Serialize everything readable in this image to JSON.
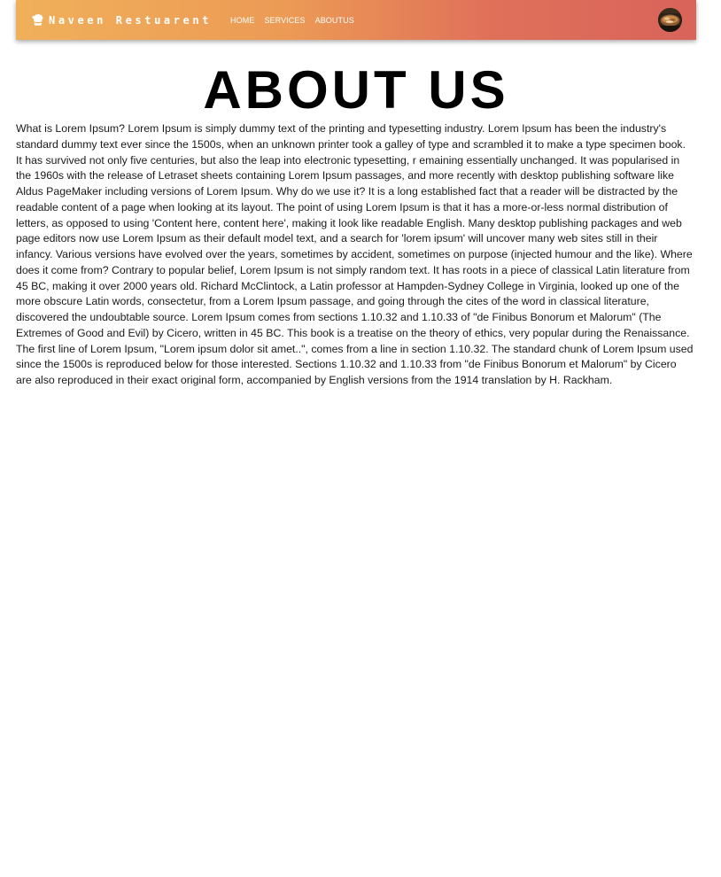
{
  "navbar": {
    "brand_icon": "chef-hat-icon",
    "brand_name": "Naveen Restuarent",
    "links": [
      {
        "label": "HOME"
      },
      {
        "label": "SERVICES"
      },
      {
        "label": "ABOUTUS"
      }
    ],
    "avatar_icon": "food-avatar-image",
    "gradient_colors": [
      "#f0b05a",
      "#e0705a",
      "#d8645a"
    ]
  },
  "main": {
    "title": "ABOUT US",
    "body": "What is Lorem Ipsum? Lorem Ipsum is simply dummy text of the printing and typesetting industry. Lorem Ipsum has been the industry's standard dummy text ever since the 1500s, when an unknown printer took a galley of type and scrambled it to make a type specimen book. It has survived not only five centuries, but also the leap into electronic typesetting, r emaining essentially unchanged. It was popularised in the 1960s with the release of Letraset sheets containing Lorem Ipsum passages, and more recently with desktop publishing software like Aldus PageMaker including versions of Lorem Ipsum. Why do we use it? It is a long established fact that a reader will be distracted by the readable content of a page when looking at its layout. The point of using Lorem Ipsum is that it has a more-or-less normal distribution of letters, as opposed to using 'Content here, content here', making it look like readable English. Many desktop publishing packages and web page editors now use Lorem Ipsum as their default model text, and a search for 'lorem ipsum' will uncover many web sites still in their infancy. Various versions have evolved over the years, sometimes by accident, sometimes on purpose (injected humour and the like). Where does it come from? Contrary to popular belief, Lorem Ipsum is not simply random text. It has roots in a piece of classical Latin literature from 45 BC, making it over 2000 years old. Richard McClintock, a Latin professor at Hampden-Sydney College in Virginia, looked up one of the more obscure Latin words, consectetur, from a Lorem Ipsum passage, and going through the cites of the word in classical literature, discovered the undoubtable source. Lorem Ipsum comes from sections 1.10.32 and 1.10.33 of \"de Finibus Bonorum et Malorum\" (The Extremes of Good and Evil) by Cicero, written in 45 BC. This book is a treatise on the theory of ethics, very popular during the Renaissance. The first line of Lorem Ipsum, \"Lorem ipsum dolor sit amet..\", comes from a line in section 1.10.32. The standard chunk of Lorem Ipsum used since the 1500s is reproduced below for those interested. Sections 1.10.32 and 1.10.33 from \"de Finibus Bonorum et Malorum\" by Cicero are also reproduced in their exact original form, accompanied by English versions from the 1914 translation by H. Rackham."
  }
}
